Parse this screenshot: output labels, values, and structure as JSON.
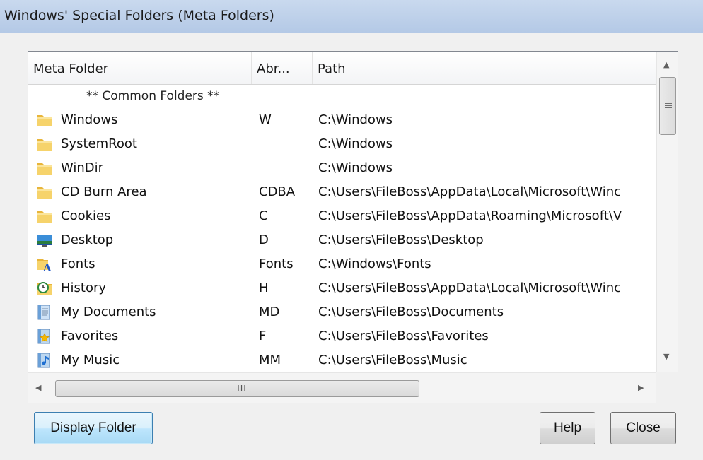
{
  "window": {
    "title": "Windows' Special Folders (Meta Folders)"
  },
  "list": {
    "columns": [
      "Meta Folder",
      "Abr...",
      "Path"
    ],
    "rows": [
      {
        "name": "** Common Folders **",
        "abbr": "",
        "path": "",
        "icon": "none",
        "group_header": true
      },
      {
        "name": "Windows",
        "abbr": "W",
        "path": "C:\\Windows",
        "icon": "folder-icon"
      },
      {
        "name": "SystemRoot",
        "abbr": "",
        "path": "C:\\Windows",
        "icon": "folder-icon"
      },
      {
        "name": "WinDir",
        "abbr": "",
        "path": "C:\\Windows",
        "icon": "folder-icon"
      },
      {
        "name": "CD Burn Area",
        "abbr": "CDBA",
        "path": "C:\\Users\\FileBoss\\AppData\\Local\\Microsoft\\Winc",
        "icon": "folder-icon"
      },
      {
        "name": "Cookies",
        "abbr": "C",
        "path": "C:\\Users\\FileBoss\\AppData\\Roaming\\Microsoft\\V",
        "icon": "folder-icon"
      },
      {
        "name": "Desktop",
        "abbr": "D",
        "path": "C:\\Users\\FileBoss\\Desktop",
        "icon": "desktop-icon"
      },
      {
        "name": "Fonts",
        "abbr": "Fonts",
        "path": "C:\\Windows\\Fonts",
        "icon": "fonts-folder-icon"
      },
      {
        "name": "History",
        "abbr": "H",
        "path": "C:\\Users\\FileBoss\\AppData\\Local\\Microsoft\\Winc",
        "icon": "history-icon"
      },
      {
        "name": "My Documents",
        "abbr": "MD",
        "path": "C:\\Users\\FileBoss\\Documents",
        "icon": "documents-icon"
      },
      {
        "name": "Favorites",
        "abbr": "F",
        "path": "C:\\Users\\FileBoss\\Favorites",
        "icon": "favorites-icon"
      },
      {
        "name": "My Music",
        "abbr": "MM",
        "path": "C:\\Users\\FileBoss\\Music",
        "icon": "music-icon"
      }
    ],
    "hscroll_grip": "III"
  },
  "buttons": {
    "display_folder": "Display Folder",
    "help": "Help",
    "close": "Close"
  }
}
